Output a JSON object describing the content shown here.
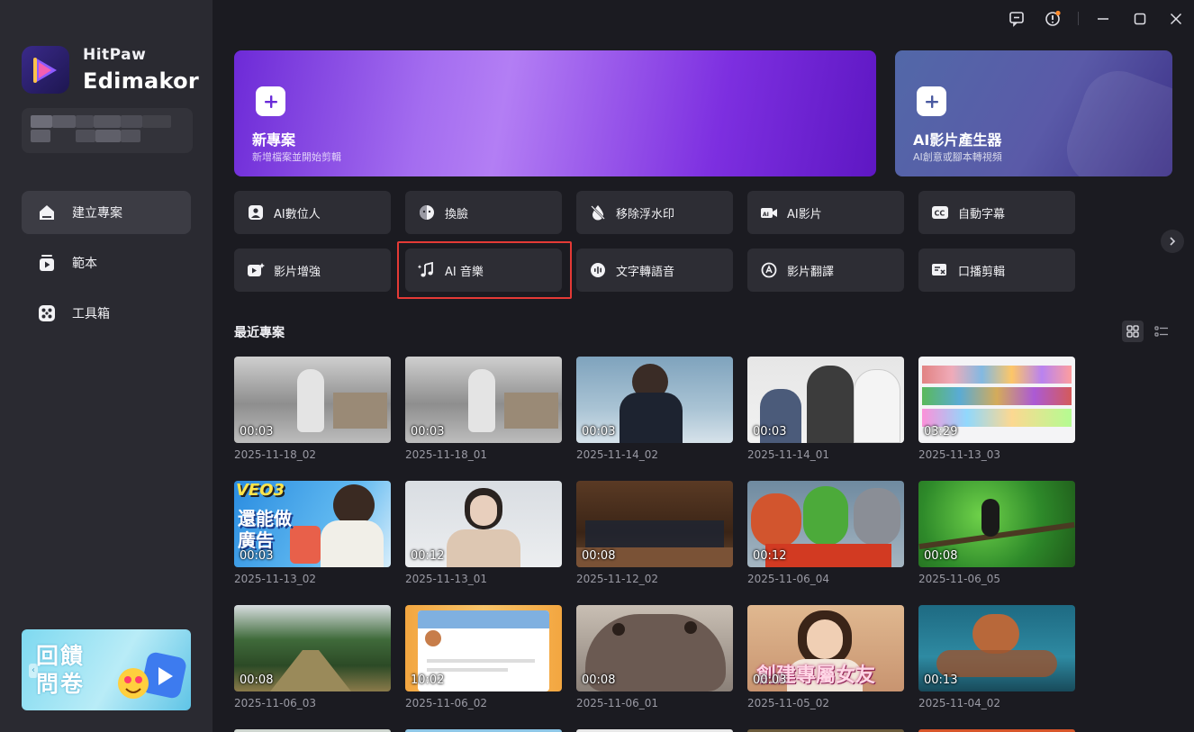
{
  "sidebar": {
    "brand_top": "HitPaw",
    "brand_main": "Edimakor",
    "nav": [
      {
        "label": "建立專案",
        "icon": "home-icon",
        "active": true
      },
      {
        "label": "範本",
        "icon": "template-icon",
        "active": false
      },
      {
        "label": "工具箱",
        "icon": "toolbox-icon",
        "active": false
      }
    ],
    "promo": {
      "line1": "回饋",
      "line2": "問卷"
    }
  },
  "window_controls": [
    "feedback-icon",
    "notification-icon",
    "minimize-icon",
    "maximize-icon",
    "close-icon"
  ],
  "hero": {
    "new_project": {
      "title": "新專案",
      "subtitle": "新增檔案並開始剪輯"
    },
    "ai_video": {
      "title": "AI影片產生器",
      "subtitle": "AI創意或腳本轉視頻"
    }
  },
  "tools": [
    {
      "label": "AI數位人",
      "icon": "avatar-icon"
    },
    {
      "label": "換臉",
      "icon": "face-swap-icon"
    },
    {
      "label": "移除浮水印",
      "icon": "watermark-remove-icon"
    },
    {
      "label": "AI影片",
      "icon": "ai-video-icon"
    },
    {
      "label": "自動字幕",
      "icon": "cc-icon"
    },
    {
      "label": "影片增強",
      "icon": "enhance-icon"
    },
    {
      "label": "AI 音樂",
      "icon": "music-icon"
    },
    {
      "label": "文字轉語音",
      "icon": "tts-icon"
    },
    {
      "label": "影片翻譯",
      "icon": "translate-icon"
    },
    {
      "label": "口播剪輯",
      "icon": "talk-edit-icon"
    }
  ],
  "recent": {
    "title": "最近專案",
    "projects": [
      {
        "name": "2025-11-18_02",
        "duration": "00:03"
      },
      {
        "name": "2025-11-18_01",
        "duration": "00:03"
      },
      {
        "name": "2025-11-14_02",
        "duration": "00:03"
      },
      {
        "name": "2025-11-14_01",
        "duration": "00:03"
      },
      {
        "name": "2025-11-13_03",
        "duration": "03:29"
      },
      {
        "name": "2025-11-13_02",
        "duration": "00:03",
        "overlay": [
          "VEO3",
          "還能做",
          "廣告"
        ]
      },
      {
        "name": "2025-11-13_01",
        "duration": "00:12"
      },
      {
        "name": "2025-11-12_02",
        "duration": "00:08"
      },
      {
        "name": "2025-11-06_04",
        "duration": "00:12"
      },
      {
        "name": "2025-11-06_05",
        "duration": "00:08"
      },
      {
        "name": "2025-11-06_03",
        "duration": "00:08"
      },
      {
        "name": "2025-11-06_02",
        "duration": "10:02"
      },
      {
        "name": "2025-11-06_01",
        "duration": "00:08"
      },
      {
        "name": "2025-11-05_02",
        "duration": "00:03",
        "overlay": [
          "創建專屬女友"
        ]
      },
      {
        "name": "2025-11-04_02",
        "duration": "00:13"
      }
    ]
  },
  "colors": {
    "accent_purple": "#8a3ff0",
    "highlight_red": "#e53a36",
    "sidebar_bg": "#2a2a31",
    "main_bg": "#1b1b21"
  }
}
